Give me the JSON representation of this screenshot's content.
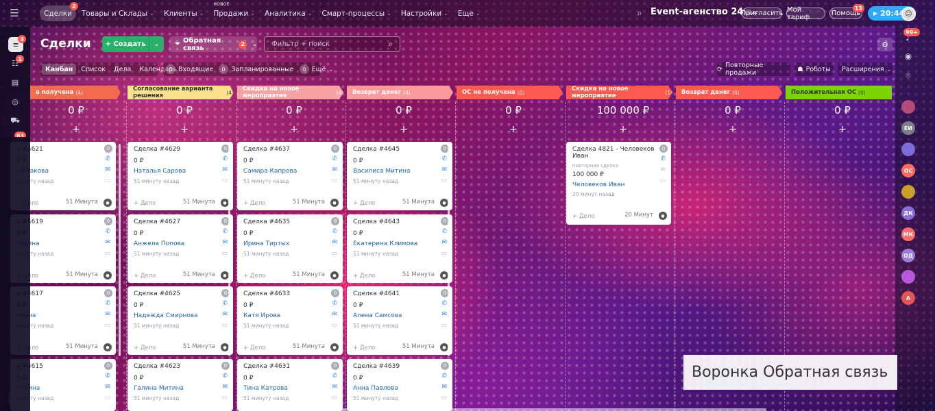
{
  "nav": [
    {
      "label": "Сделки",
      "active": true,
      "badge": "2"
    },
    {
      "label": "Товары и Склады",
      "chev": "⌄"
    },
    {
      "label": "Клиенты",
      "chev": "⌄"
    },
    {
      "label": "Продажи",
      "chev": "⌄",
      "tag": "НОВОЕ"
    },
    {
      "label": "Аналитика",
      "chev": "⌄"
    },
    {
      "label": "Смарт-процессы",
      "chev": "⌄"
    },
    {
      "label": "Настройки",
      "chev": "⌄"
    },
    {
      "label": "Еще",
      "chev": "⌄"
    }
  ],
  "header": {
    "org": "Event-агенство 24",
    "invite": "Пригласить",
    "plan": "Мой тариф",
    "help": "Помощь",
    "help_badge": "13",
    "clock": "20:44"
  },
  "page": {
    "title": "Сделки",
    "create": "Создать",
    "funnel": "Обратная связь",
    "funnel_badge": "2",
    "search_placeholder": "Фильтр + поиск"
  },
  "views": [
    "Канбан",
    "Список",
    "Дела",
    "Календарь"
  ],
  "counters": [
    {
      "n": "0",
      "label": "Входящие"
    },
    {
      "n": "0",
      "label": "Запланированные"
    },
    {
      "n": "0",
      "label": "Ещё"
    }
  ],
  "toolbar": {
    "repeat": "Повторные продажи",
    "robots": "Роботы",
    "ext": "Расширения"
  },
  "stages": [
    {
      "name": "а получена",
      "count": "(4)",
      "sum": "0 ₽",
      "color": "#f26b4f"
    },
    {
      "name": "Согласование варианта решения",
      "count": "(4)",
      "sum": "0 ₽",
      "color": "#fce18c",
      "dark": true
    },
    {
      "name": "Скидка на новое мероприятие",
      "count": "(4)",
      "sum": "0 ₽",
      "color": "#f7a3a3"
    },
    {
      "name": "Возврат денег",
      "count": "(4)",
      "sum": "0 ₽",
      "color": "#fa9a9a"
    },
    {
      "name": "ОС не получена",
      "count": "(0)",
      "sum": "0 ₽",
      "color": "#ff5a4f"
    },
    {
      "name": "Скидка на новое мероприятие",
      "count": "(1)",
      "sum": "100 000 ₽",
      "color": "#ff5a4f"
    },
    {
      "name": "Возврат денег",
      "count": "(0)",
      "sum": "0 ₽",
      "color": "#ff5a4f"
    },
    {
      "name": "Положительная ОС",
      "count": "(0)",
      "sum": "0 ₽",
      "color": "#7bd500",
      "dark": true
    }
  ],
  "columns": [
    [
      {
        "title": "а #4621",
        "price": "0 ₽",
        "name": "на Ракова",
        "time": "минуту назад",
        "ago": "51 Минута"
      },
      {
        "title": "а #4619",
        "price": "0 ₽",
        "name": "Ракина",
        "time": "минуту назад",
        "ago": "51 Минута"
      },
      {
        "title": "а #4617",
        "price": "0 ₽",
        "name": "нтина",
        "time": "минуту назад",
        "ago": "51 Минута"
      },
      {
        "title": "а #4615",
        "price": "0 ₽",
        "name": "Катина",
        "time": "минуту назад",
        "ago": ""
      }
    ],
    [
      {
        "title": "Сделка #4629",
        "price": "0 ₽",
        "name": "Наталья Сарова",
        "time": "51 минуту назад",
        "ago": "51 Минута"
      },
      {
        "title": "Сделка #4627",
        "price": "0 ₽",
        "name": "Анжела Попова",
        "time": "51 минуту назад",
        "ago": "51 Минута"
      },
      {
        "title": "Сделка #4625",
        "price": "0 ₽",
        "name": "Надежда Смирнова",
        "time": "51 минуту назад",
        "ago": "51 Минута"
      },
      {
        "title": "Сделка #4623",
        "price": "0 ₽",
        "name": "Галина Митина",
        "time": "51 минуту назад",
        "ago": ""
      }
    ],
    [
      {
        "title": "Сделка #4637",
        "price": "0 ₽",
        "name": "Самира Капрова",
        "time": "51 минуту назад",
        "ago": "51 Минута"
      },
      {
        "title": "Сделка #4635",
        "price": "0 ₽",
        "name": "Ирина Тиртых",
        "time": "51 минуту назад",
        "ago": "51 Минута"
      },
      {
        "title": "Сделка #4633",
        "price": "0 ₽",
        "name": "Катя Ирова",
        "time": "51 минуту назад",
        "ago": "51 Минута"
      },
      {
        "title": "Сделка #4631",
        "price": "0 ₽",
        "name": "Тина Катрова",
        "time": "51 минуту назад",
        "ago": ""
      }
    ],
    [
      {
        "title": "Сделка #4645",
        "price": "0 ₽",
        "name": "Василиса Митина",
        "time": "51 минуту назад",
        "ago": "51 Минута"
      },
      {
        "title": "Сделка #4643",
        "price": "0 ₽",
        "name": "Екатерина Климова",
        "time": "51 минуту назад",
        "ago": "51 Минута"
      },
      {
        "title": "Сделка #4641",
        "price": "0 ₽",
        "name": "Алена Самсова",
        "time": "51 минуту назад",
        "ago": "51 Минута"
      },
      {
        "title": "Сделка #4639",
        "price": "0 ₽",
        "name": "Анна Павлова",
        "time": "51 минуту назад",
        "ago": ""
      }
    ]
  ],
  "big_card": {
    "title": "Сделка 4821 - Человеков Иван",
    "sub": "повторная сделка",
    "price": "100 000 ₽",
    "name": "Человеков Иван",
    "time": "20 минут назад",
    "ago": "20 Минут"
  },
  "card_common": {
    "badge": "0",
    "action": "+ Дело"
  },
  "overlay": "Воронка Обратная связь",
  "left_badges": {
    "b1": "3",
    "b2": "1",
    "b3": "83"
  },
  "left_avatars": [
    "МО",
    "WW",
    "КМ"
  ],
  "right_badge": "99+",
  "right_avatars": [
    {
      "t": "",
      "c": "#b44b78"
    },
    {
      "t": "ЕИ",
      "c": "#7a7f8a"
    },
    {
      "t": "",
      "c": "#7c6cd8"
    },
    {
      "t": "ОС",
      "c": "#ff6b5e"
    },
    {
      "t": "",
      "c": "#caa02d"
    },
    {
      "t": "ДК",
      "c": "#8a6bd9"
    },
    {
      "t": "МК",
      "c": "#ff6b6b"
    },
    {
      "t": "ОД",
      "c": "#9a7fd9"
    },
    {
      "t": "",
      "c": "#b65ad9"
    },
    {
      "t": "А",
      "c": "#e25555"
    }
  ],
  "colors": {
    "accent": "#29b06b",
    "link": "#2067b0",
    "badge": "#ff5752",
    "clock": "#2fa8ff"
  }
}
